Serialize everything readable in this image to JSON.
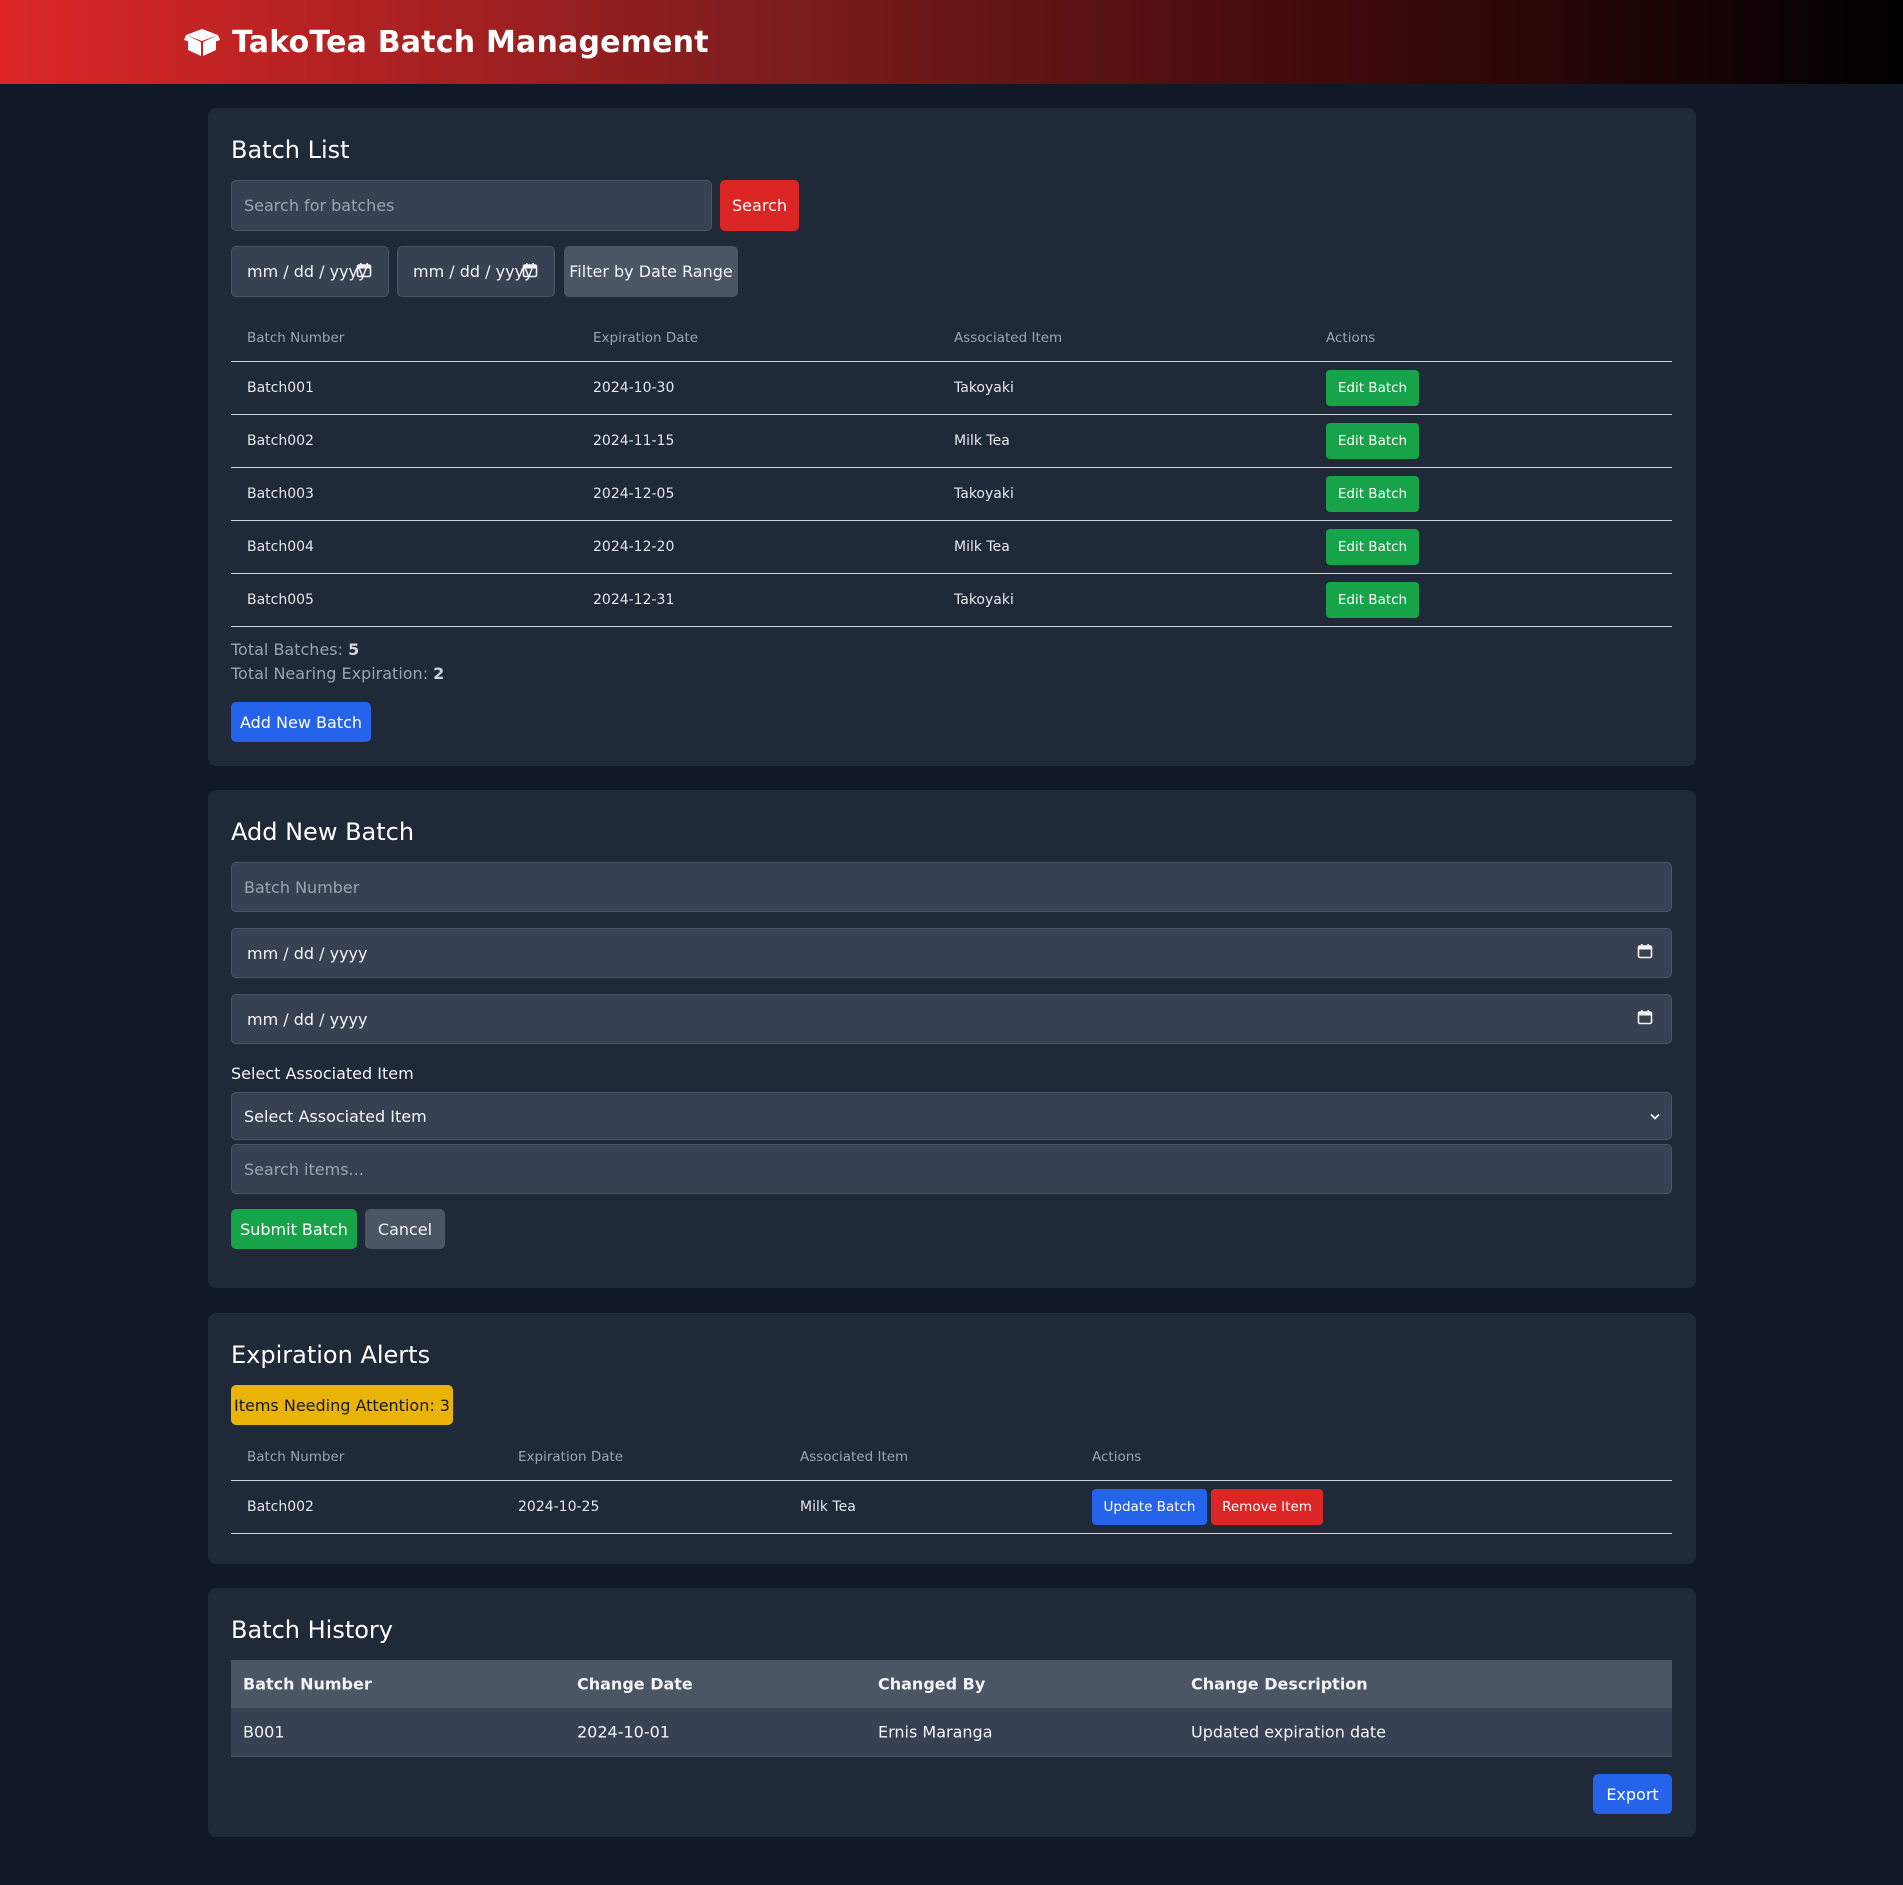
{
  "header": {
    "title": "TakoTea Batch Management"
  },
  "batch_list": {
    "title": "Batch List",
    "search_placeholder": "Search for batches",
    "search_label": "Search",
    "date_from": "mm / dd / yyyy",
    "date_to": "mm / dd / yyyy",
    "filter_label": "Filter by Date Range",
    "columns": [
      "Batch Number",
      "Expiration Date",
      "Associated Item",
      "Actions"
    ],
    "rows": [
      {
        "batch": "Batch001",
        "expiry": "2024-10-30",
        "item": "Takoyaki",
        "action": "Edit Batch"
      },
      {
        "batch": "Batch002",
        "expiry": "2024-11-15",
        "item": "Milk Tea",
        "action": "Edit Batch"
      },
      {
        "batch": "Batch003",
        "expiry": "2024-12-05",
        "item": "Takoyaki",
        "action": "Edit Batch"
      },
      {
        "batch": "Batch004",
        "expiry": "2024-12-20",
        "item": "Milk Tea",
        "action": "Edit Batch"
      },
      {
        "batch": "Batch005",
        "expiry": "2024-12-31",
        "item": "Takoyaki",
        "action": "Edit Batch"
      }
    ],
    "total_batches_label": "Total Batches: ",
    "total_batches": "5",
    "total_nearing_label": "Total Nearing Expiration: ",
    "total_nearing": "2",
    "add_label": "Add New Batch"
  },
  "add_batch": {
    "title": "Add New Batch",
    "batch_number_placeholder": "Batch Number",
    "date_1": "mm / dd / yyyy",
    "date_2": "mm / dd / yyyy",
    "select_label": "Select Associated Item",
    "select_value": "Select Associated Item",
    "search_items_placeholder": "Search items...",
    "submit_label": "Submit Batch",
    "cancel_label": "Cancel"
  },
  "alerts": {
    "title": "Expiration Alerts",
    "badge": "Items Needing Attention: 3",
    "columns": [
      "Batch Number",
      "Expiration Date",
      "Associated Item",
      "Actions"
    ],
    "rows": [
      {
        "batch": "Batch002",
        "expiry": "2024-10-25",
        "item": "Milk Tea",
        "update": "Update Batch",
        "remove": "Remove Item"
      }
    ]
  },
  "history": {
    "title": "Batch History",
    "columns": [
      "Batch Number",
      "Change Date",
      "Changed By",
      "Change Description"
    ],
    "rows": [
      {
        "batch": "B001",
        "date": "2024-10-01",
        "by": "Ernis Maranga",
        "desc": "Updated expiration date"
      }
    ],
    "export_label": "Export"
  },
  "colors": {
    "accent_red": "#dc2626",
    "accent_blue": "#2563eb",
    "accent_green": "#16a34a",
    "accent_yellow": "#eab308",
    "card": "#1f2937",
    "background": "#111827"
  },
  "icons": [
    "box-icon",
    "calendar-icon",
    "chevron-down-icon"
  ]
}
